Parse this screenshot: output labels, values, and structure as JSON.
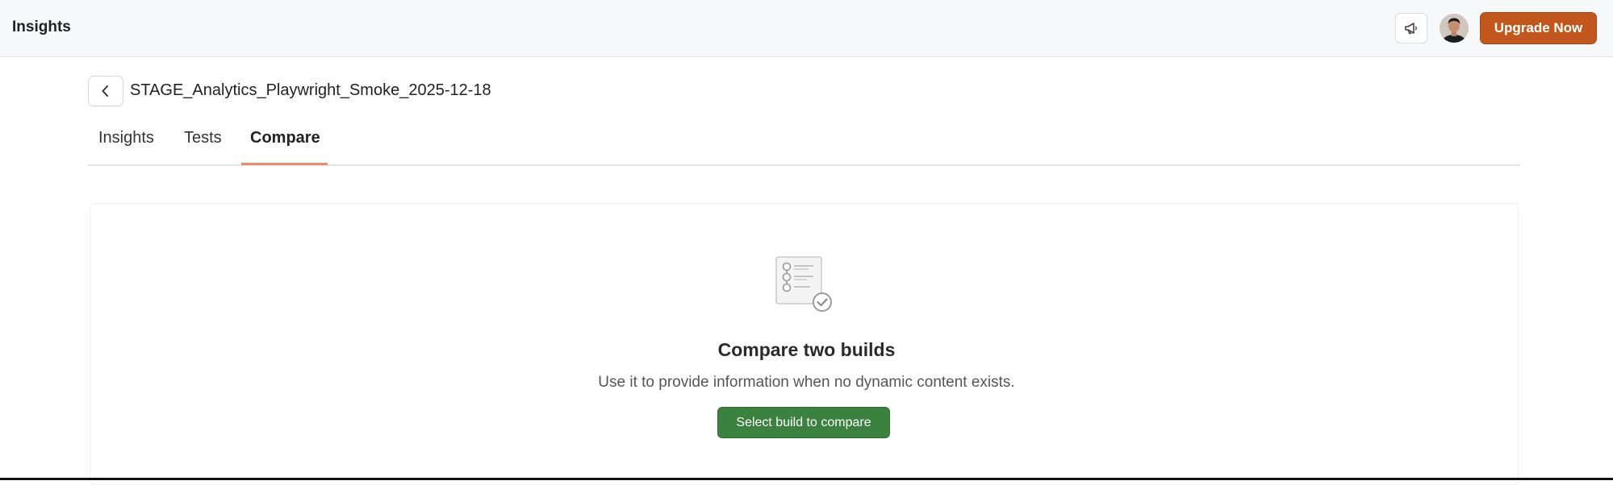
{
  "header": {
    "app_title": "Insights",
    "announcement_icon": "megaphone-icon",
    "upgrade_label": "Upgrade Now",
    "upgrade_color": "#c2571e"
  },
  "build": {
    "back_icon": "chevron-left-icon",
    "name": "STAGE_Analytics_Playwright_Smoke_2025-12-18"
  },
  "tabs": [
    {
      "label": "Insights",
      "active": false
    },
    {
      "label": "Tests",
      "active": false
    },
    {
      "label": "Compare",
      "active": true
    }
  ],
  "tab_accent_color": "#e98b6e",
  "empty_state": {
    "icon": "checklist-icon",
    "title": "Compare two builds",
    "description": "Use it to provide information when no dynamic content exists.",
    "button_label": "Select build to compare",
    "button_color": "#3b8140"
  }
}
